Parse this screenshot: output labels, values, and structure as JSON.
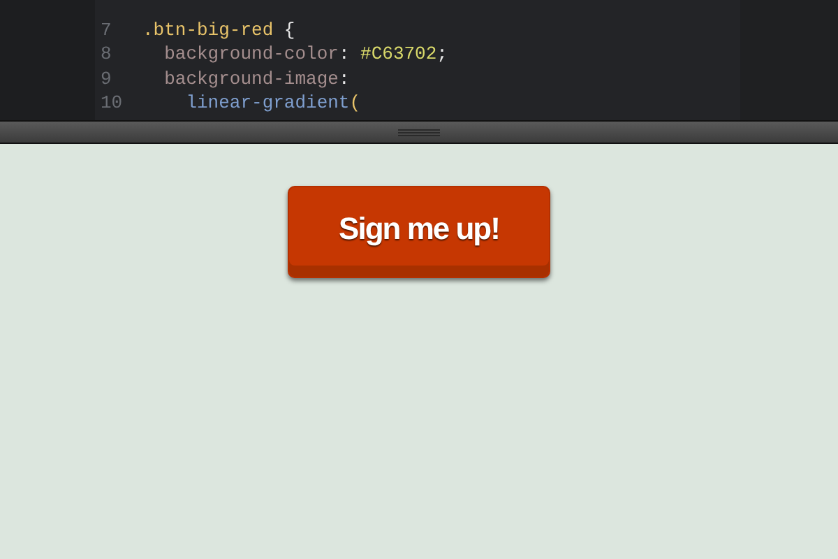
{
  "editor": {
    "lines": [
      {
        "number": "7",
        "tokens": [
          {
            "text": ".btn-big-red",
            "kind": "selector"
          },
          {
            "text": " {",
            "kind": "punct"
          }
        ]
      },
      {
        "number": "8",
        "tokens": [
          {
            "text": "  background-color",
            "kind": "property"
          },
          {
            "text": ": ",
            "kind": "punct"
          },
          {
            "text": "#C63702",
            "kind": "value"
          },
          {
            "text": ";",
            "kind": "punct"
          }
        ]
      },
      {
        "number": "9",
        "tokens": [
          {
            "text": "  background-image",
            "kind": "property"
          },
          {
            "text": ":",
            "kind": "punct"
          }
        ]
      },
      {
        "number": "10",
        "tokens": [
          {
            "text": "    linear-gradient",
            "kind": "function"
          },
          {
            "text": "(",
            "kind": "paren"
          }
        ]
      }
    ]
  },
  "preview": {
    "button": "Sign me up!"
  }
}
